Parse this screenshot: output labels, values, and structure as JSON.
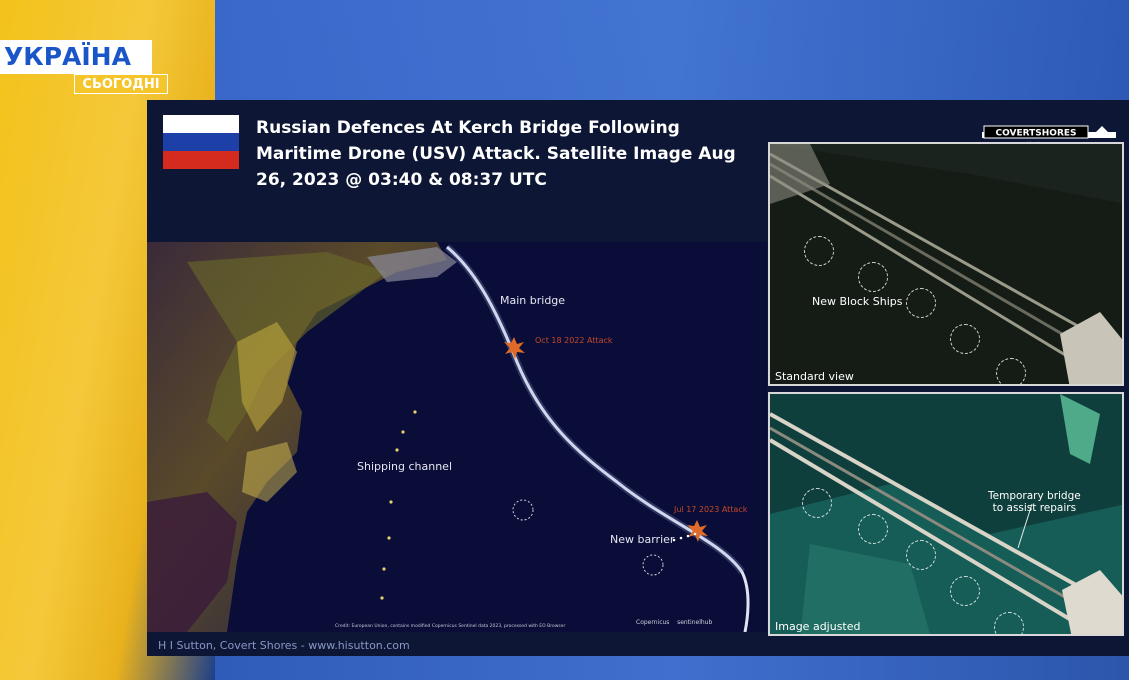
{
  "broadcast": {
    "logo_top": "УКРАЇНА",
    "logo_bottom": "СЬОГОДНІ"
  },
  "slide": {
    "title_line1": "Russian Defences At Kerch Bridge Following",
    "title_line2": "Maritime Drone (USV) Attack. Satellite Image Aug",
    "title_line3": "26, 2023 @ 03:40 & 08:37 UTC",
    "flag_colors": [
      "#ffffff",
      "#1c3fa8",
      "#d52b1e"
    ],
    "publisher_logo": "COVERTSHORES",
    "publisher_site": "www.hisutton.com"
  },
  "main_map": {
    "labels": {
      "main_bridge": "Main bridge",
      "oct_attack": "Oct 18 2022 Attack",
      "shipping_channel": "Shipping channel",
      "jul_attack": "Jul 17 2023 Attack",
      "new_barrier": "New barrier"
    },
    "credit": "Credit: European Union, contains modified Copernicus Sentinel data 2023, processed with EO Browser",
    "partner_logos": [
      "Copernicus",
      "sentinelhub"
    ],
    "footer": "H I Sutton, Covert Shores - www.hisutton.com"
  },
  "insets": {
    "top": {
      "label": "Standard view",
      "annotation": "New Block Ships"
    },
    "bottom": {
      "label": "Image adjusted",
      "annotation_line1": "Temporary bridge",
      "annotation_line2": "to assist repairs"
    }
  },
  "colors": {
    "accent_yellow": "#f4c83a",
    "channel_blue": "#2e5bb0",
    "attack_red": "#c8472a"
  }
}
